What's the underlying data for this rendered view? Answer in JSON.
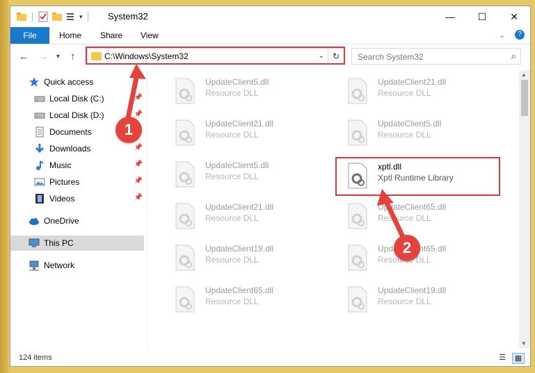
{
  "window": {
    "title": "System32",
    "qat_icons": [
      "folder-icon",
      "properties-check-icon",
      "new-folder-icon",
      "customize-icon"
    ]
  },
  "ribbon": {
    "file_tab": "File",
    "tabs": [
      "Home",
      "Share",
      "View"
    ]
  },
  "address": {
    "path": "C:\\Windows\\System32"
  },
  "search": {
    "placeholder": "Search System32"
  },
  "sidebar": {
    "items": [
      {
        "label": "Quick access",
        "icon": "star-icon",
        "pinned": false
      },
      {
        "label": "Local Disk (C:)",
        "icon": "drive-icon",
        "pinned": true
      },
      {
        "label": "Local Disk (D:)",
        "icon": "drive-icon",
        "pinned": true
      },
      {
        "label": "Documents",
        "icon": "documents-icon",
        "pinned": true
      },
      {
        "label": "Downloads",
        "icon": "downloads-icon",
        "pinned": true
      },
      {
        "label": "Music",
        "icon": "music-icon",
        "pinned": true
      },
      {
        "label": "Pictures",
        "icon": "pictures-icon",
        "pinned": true
      },
      {
        "label": "Videos",
        "icon": "videos-icon",
        "pinned": true
      },
      {
        "label": "OneDrive",
        "icon": "cloud-icon",
        "pinned": false
      },
      {
        "label": "This PC",
        "icon": "computer-icon",
        "pinned": false,
        "selected": true
      },
      {
        "label": "Network",
        "icon": "network-icon",
        "pinned": false
      }
    ]
  },
  "files": {
    "left": [
      {
        "name": "UpdateClient5.dll",
        "type": "Resource DLL"
      },
      {
        "name": "UpdateClient21.dll",
        "type": "Resource DLL"
      },
      {
        "name": "UpdateClient5.dll",
        "type": "Resource DLL"
      },
      {
        "name": "UpdateClient21.dll",
        "type": "Resource DLL"
      },
      {
        "name": "UpdateClient19.dll",
        "type": "Resource DLL"
      },
      {
        "name": "UpdateClient65.dll",
        "type": "Resource DLL"
      }
    ],
    "right": [
      {
        "name": "UpdateClient21.dll",
        "type": "Resource DLL"
      },
      {
        "name": "UpdateClient5.dll",
        "type": "Resource DLL"
      },
      {
        "name": "xptl.dll",
        "type": "Xptl Runtime Library",
        "active": true
      },
      {
        "name": "UpdateClient65.dll",
        "type": "Resource DLL"
      },
      {
        "name": "UpdateClient65.dll",
        "type": "Resource DLL"
      },
      {
        "name": "UpdateClient19.dll",
        "type": "Resource DLL"
      }
    ]
  },
  "status": {
    "item_count": "124 items"
  },
  "annotations": {
    "step1": "1",
    "step2": "2"
  },
  "colors": {
    "accent": "#1979ca",
    "highlight": "#d9363e",
    "badge": "#e2433d"
  }
}
